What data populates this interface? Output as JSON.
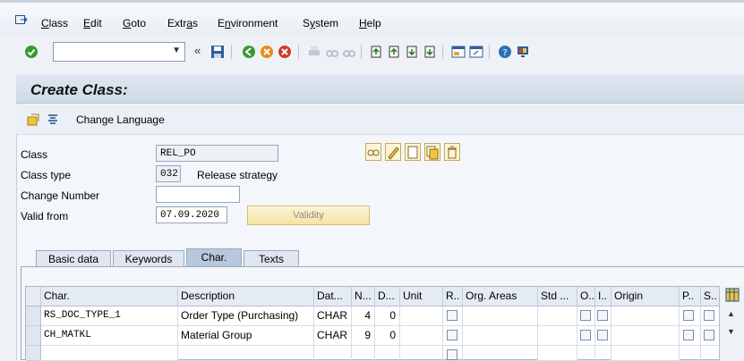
{
  "menu": {
    "items": [
      {
        "pre": "",
        "u": "C",
        "post": "lass"
      },
      {
        "pre": "",
        "u": "E",
        "post": "dit"
      },
      {
        "pre": "",
        "u": "G",
        "post": "oto"
      },
      {
        "pre": "Extr",
        "u": "a",
        "post": "s"
      },
      {
        "pre": "E",
        "u": "n",
        "post": "vironment"
      },
      {
        "pre": "S",
        "u": "y",
        "post": "stem"
      },
      {
        "pre": "",
        "u": "H",
        "post": "elp"
      }
    ]
  },
  "toolbar": {
    "command_value": "",
    "nav_back_glyph": "«"
  },
  "title": "Create Class:",
  "app_toolbar": {
    "change_language": "Change Language"
  },
  "form": {
    "class_label": "Class",
    "class_value": "REL_PO",
    "class_type_label": "Class type",
    "class_type_value": "032",
    "class_type_text": "Release strategy",
    "change_number_label": "Change Number",
    "change_number_value": "",
    "valid_from_label": "Valid from",
    "valid_from_value": "07.09.2020",
    "validity_button": "Validity"
  },
  "tabs": [
    {
      "label": "Basic data",
      "active": false
    },
    {
      "label": "Keywords",
      "active": false
    },
    {
      "label": "Char.",
      "active": true
    },
    {
      "label": "Texts",
      "active": false
    }
  ],
  "table": {
    "headers": [
      "Char.",
      "Description",
      "Dat...",
      "N...",
      "D...",
      "Unit",
      "R..",
      "Org. Areas",
      "Std ...",
      "O..",
      "I..",
      "Origin",
      "P..",
      "S.."
    ],
    "rows": [
      {
        "char": "RS_DOC_TYPE_1",
        "desc": "Order Type (Purchasing)",
        "dt": "CHAR",
        "n": "4",
        "d": "0"
      },
      {
        "char": "CH_MATKL",
        "desc": "Material Group",
        "dt": "CHAR",
        "n": "9",
        "d": "0"
      },
      {
        "char": "",
        "desc": "",
        "dt": "",
        "n": "",
        "d": ""
      }
    ]
  },
  "colors": {
    "accent_green": "#3a9a2f",
    "window_bg": "#eef2f7",
    "validity_bg": "#f6e3a4"
  }
}
